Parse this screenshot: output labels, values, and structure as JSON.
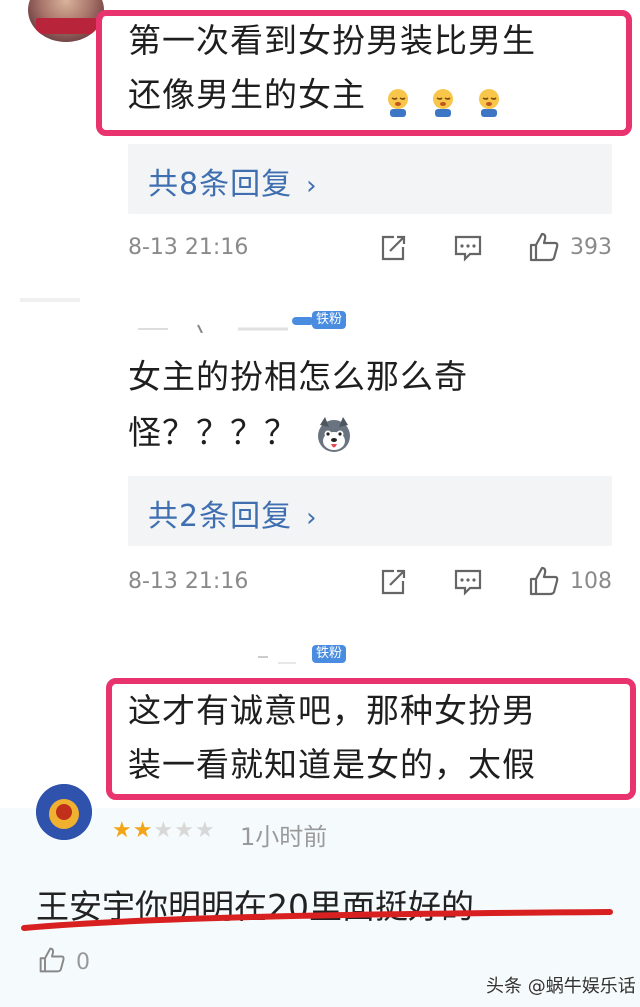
{
  "comment1": {
    "text_line1": "第一次看到女扮男装比男生",
    "text_line2": "还像男生的女主",
    "reply_label": "共8条回复",
    "chevron": "›",
    "time": "8-13 21:16",
    "likes": "393"
  },
  "comment2": {
    "badge": "铁粉",
    "text_line1": "女主的扮相怎么那么奇",
    "text_line2": "怪？？？？",
    "reply_label": "共2条回复",
    "chevron": "›",
    "time": "8-13 21:16",
    "likes": "108"
  },
  "comment3": {
    "badge": "铁粉",
    "text_line1": "这才有诚意吧，那种女扮男",
    "text_line2": "装一看就知道是女的，太假"
  },
  "review": {
    "rating": 2,
    "rating_max": 5,
    "time_ago": "1小时前",
    "text": "王安宇你明明在20里面挺好的",
    "likes": "0"
  },
  "watermark": "头条 @蜗牛娱乐话",
  "colors": {
    "highlight": "#e8336e",
    "reply_link": "#3f6fb0",
    "badge": "#4a8de0",
    "star_on": "#f2a516",
    "star_off": "#d8d8d8",
    "underline": "#d92020"
  }
}
